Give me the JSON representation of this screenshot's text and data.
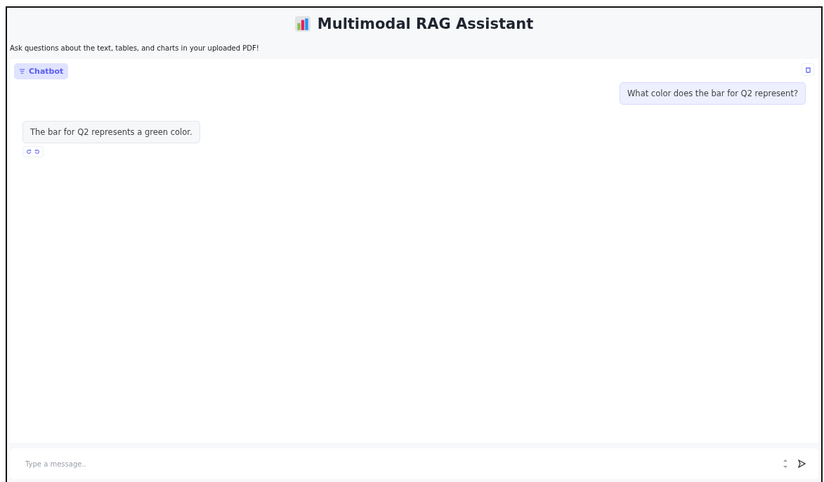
{
  "header": {
    "title": "Multimodal RAG Assistant",
    "description": "Ask questions about the text, tables, and charts in your uploaded PDF!"
  },
  "chatbot": {
    "label": "Chatbot",
    "messages": [
      {
        "kind": "user",
        "text": "What color does the bar for Q2 represent?"
      },
      {
        "kind": "bot",
        "text": "The bar for Q2 represents a green color."
      }
    ]
  },
  "input": {
    "placeholder": "Type a message.."
  }
}
